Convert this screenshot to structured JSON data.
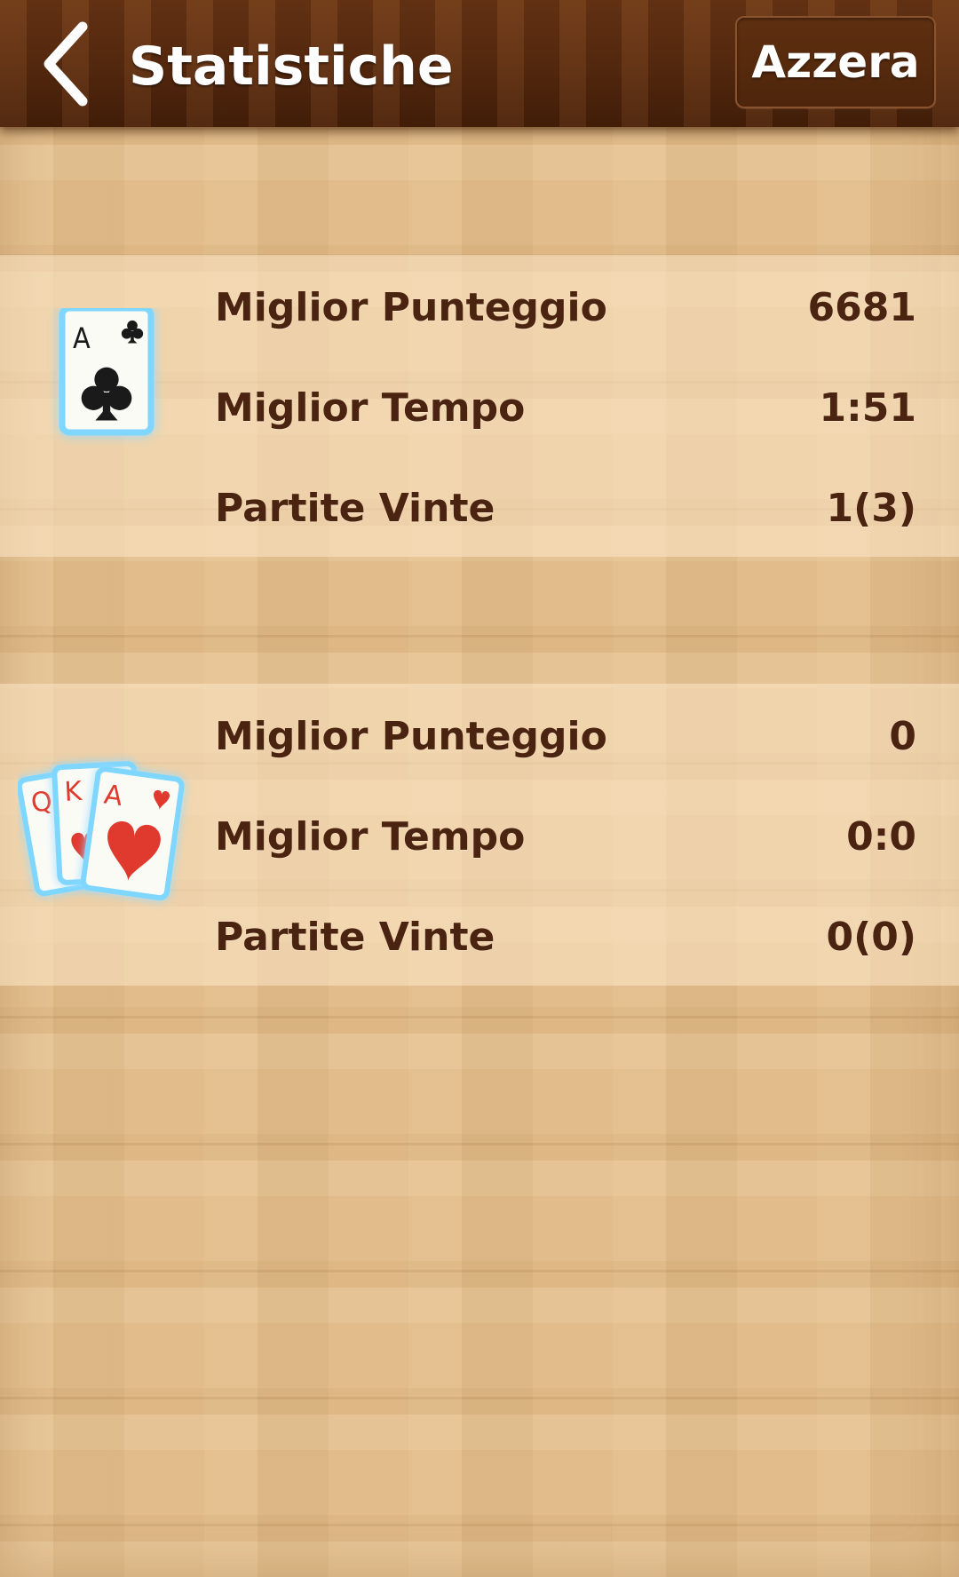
{
  "header": {
    "title": "Statistiche",
    "reset_label": "Azzera",
    "back_icon": "chevron-left-icon"
  },
  "colors": {
    "header_bg": "#5a2b0f",
    "text_dark": "#4b2411",
    "wood": "#e2bd8b",
    "card_glow": "#7fd6ff",
    "club_black": "#1a1a1a",
    "heart_red": "#e03a2f"
  },
  "sections": [
    {
      "icon": "ace-of-clubs-card-icon",
      "card_text": [
        "A"
      ],
      "stats": [
        {
          "label": "Miglior Punteggio",
          "value": "6681"
        },
        {
          "label": "Miglior Tempo",
          "value": "1:51"
        },
        {
          "label": "Partite Vinte",
          "value": "1(3)"
        }
      ]
    },
    {
      "icon": "queen-king-ace-hearts-cards-icon",
      "card_text": [
        "Q",
        "K",
        "A"
      ],
      "stats": [
        {
          "label": "Miglior Punteggio",
          "value": "0"
        },
        {
          "label": "Miglior Tempo",
          "value": "0:0"
        },
        {
          "label": "Partite Vinte",
          "value": "0(0)"
        }
      ]
    }
  ]
}
